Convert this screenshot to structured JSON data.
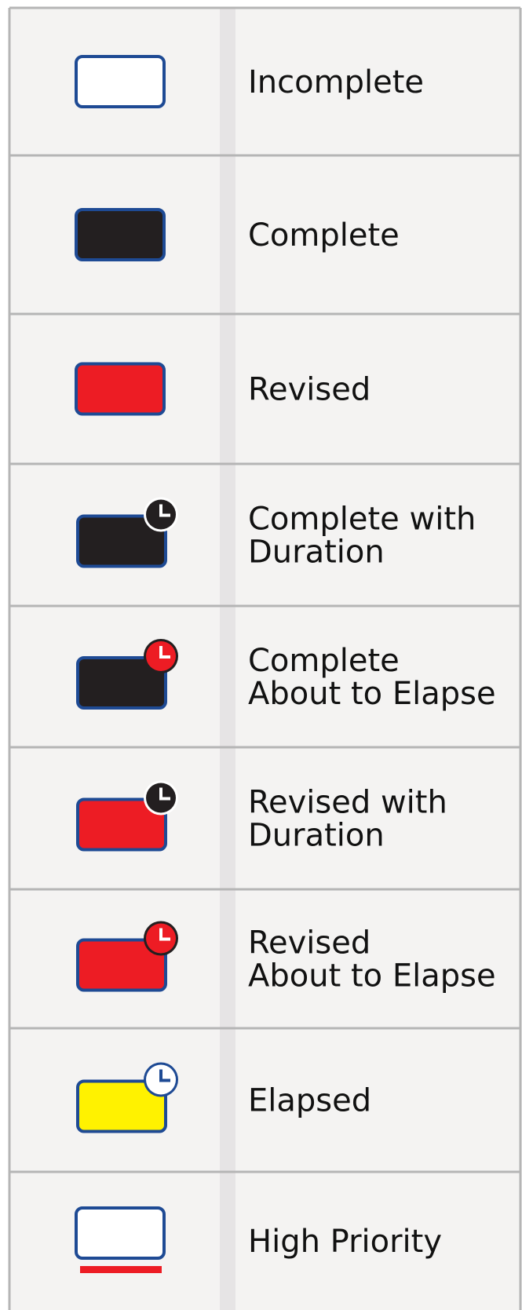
{
  "legend": {
    "colors": {
      "background": "#f4f3f2",
      "divider": "#e6e4e5",
      "grid": "#b5b5b5",
      "border_blue": "#1e4a94",
      "incomplete": "#ffffff",
      "complete": "#231f20",
      "revised": "#ed1c24",
      "elapsed": "#fff200",
      "priority_bar": "#ed1c24"
    },
    "items": [
      {
        "key": "incomplete",
        "label_lines": [
          "Incomplete"
        ],
        "fill": "#ffffff",
        "icon": null,
        "priority_bar": false
      },
      {
        "key": "complete",
        "label_lines": [
          "Complete"
        ],
        "fill": "#231f20",
        "icon": null,
        "priority_bar": false
      },
      {
        "key": "revised",
        "label_lines": [
          "Revised"
        ],
        "fill": "#ed1c24",
        "icon": null,
        "priority_bar": false
      },
      {
        "key": "complete-with-duration",
        "label_lines": [
          "Complete with",
          "Duration"
        ],
        "fill": "#231f20",
        "icon": "clock-icon-dark",
        "priority_bar": false
      },
      {
        "key": "complete-about-to-elapse",
        "label_lines": [
          "Complete",
          "About to Elapse"
        ],
        "fill": "#231f20",
        "icon": "clock-icon-red",
        "priority_bar": false
      },
      {
        "key": "revised-with-duration",
        "label_lines": [
          "Revised with",
          "Duration"
        ],
        "fill": "#ed1c24",
        "icon": "clock-icon-dark",
        "priority_bar": false
      },
      {
        "key": "revised-about-to-elapse",
        "label_lines": [
          "Revised",
          "About to Elapse"
        ],
        "fill": "#ed1c24",
        "icon": "clock-icon-red",
        "priority_bar": false
      },
      {
        "key": "elapsed",
        "label_lines": [
          "Elapsed"
        ],
        "fill": "#fff200",
        "icon": "clock-icon-white",
        "priority_bar": false
      },
      {
        "key": "high-priority",
        "label_lines": [
          "High Priority"
        ],
        "fill": "#ffffff",
        "icon": null,
        "priority_bar": true
      }
    ]
  }
}
